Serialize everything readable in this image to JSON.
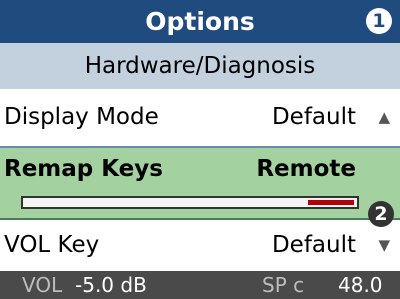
{
  "header": {
    "title": "Options",
    "badge": "1"
  },
  "subheader": {
    "title": "Hardware/Diagnosis"
  },
  "rows": [
    {
      "label": "Display Mode",
      "value": "Default",
      "arrow": "▲"
    },
    {
      "label": "Remap Keys",
      "value": "Remote",
      "badge": "2",
      "level_fraction": 0.14
    },
    {
      "label": "VOL Key",
      "value": "Default",
      "arrow": "▼"
    }
  ],
  "status": {
    "vol_label": "VOL",
    "vol_value": "-5.0 dB",
    "sp_label": "SP c",
    "sp_value": "48.0"
  },
  "colors": {
    "header": "#1f4b7f",
    "subheader": "#c3d0dd",
    "selected_row": "#a3d2a0",
    "slider_fill": "#b30008",
    "statusbar": "#4a4a4a"
  }
}
